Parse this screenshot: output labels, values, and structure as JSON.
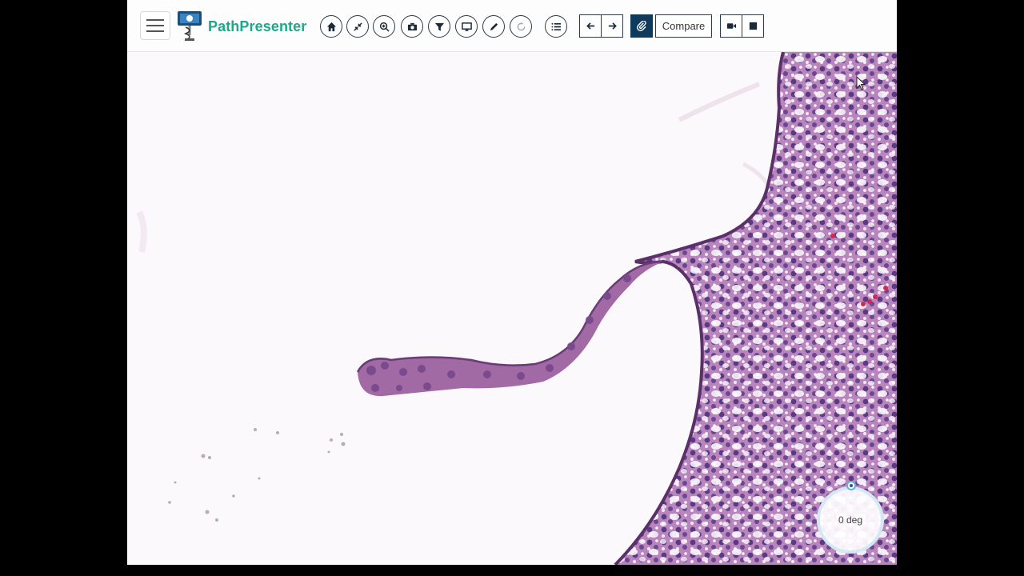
{
  "app": {
    "brand_name": "PathPresenter"
  },
  "toolbar": {
    "menu_icon": "hamburger-menu-icon",
    "logo_icon": "microscope-logo-icon",
    "circle_tools": [
      "home-icon",
      "fit-screen-icon",
      "zoom-icon",
      "camera-icon",
      "filter-icon",
      "display-icon",
      "pen-icon",
      "rotate-icon",
      "list-icon"
    ],
    "nav_tools": [
      "arrow-left-icon",
      "arrow-right-icon"
    ],
    "annotate_icon": "paperclip-icon",
    "compare_label": "Compare",
    "record_tools": [
      "video-camera-icon",
      "stop-icon"
    ]
  },
  "rotation": {
    "label": "0 deg"
  },
  "colors": {
    "brand": "#1aa98c",
    "tool_border": "#2e3a46",
    "active_tool": "#0f3a5c",
    "tissue_stain": "#8a4a90"
  }
}
